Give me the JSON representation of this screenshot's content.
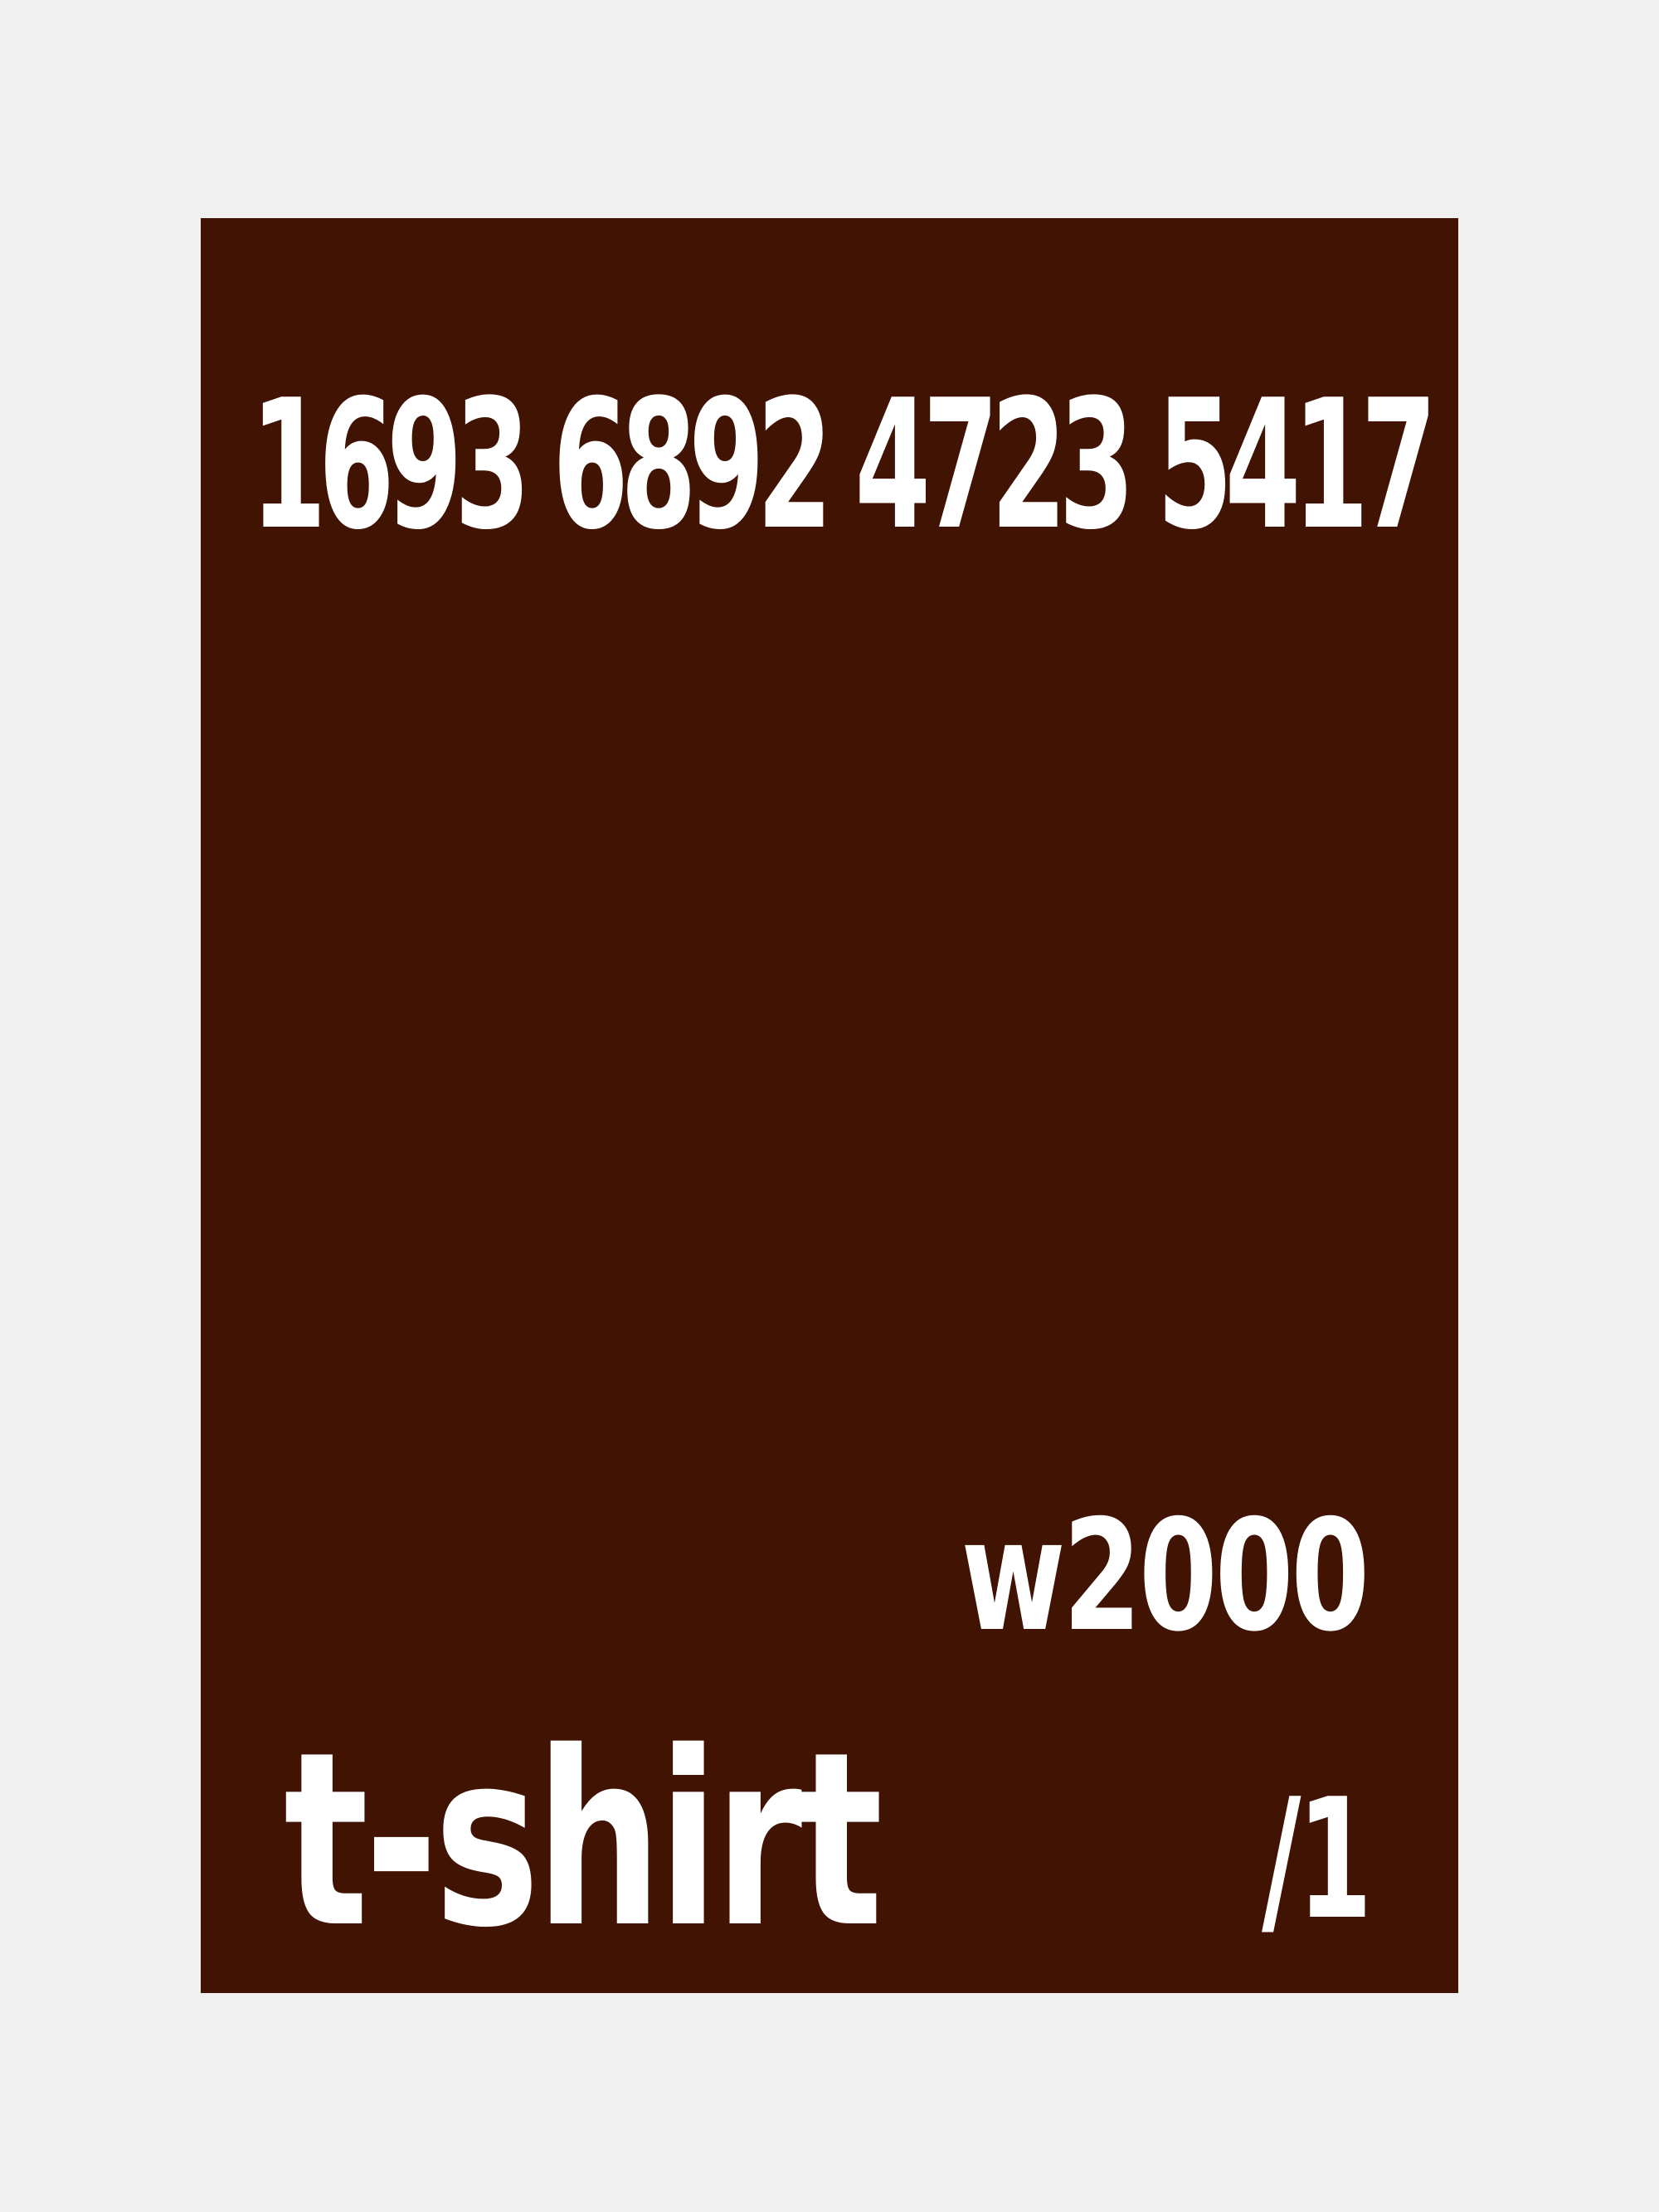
{
  "label": {
    "number": "1693 6892 4723 5417",
    "model": "w2000",
    "product": "t-shirt",
    "index": "/1"
  },
  "colors": {
    "background": "#f0f0f0",
    "card": "#401303",
    "text": "#ffffff"
  }
}
